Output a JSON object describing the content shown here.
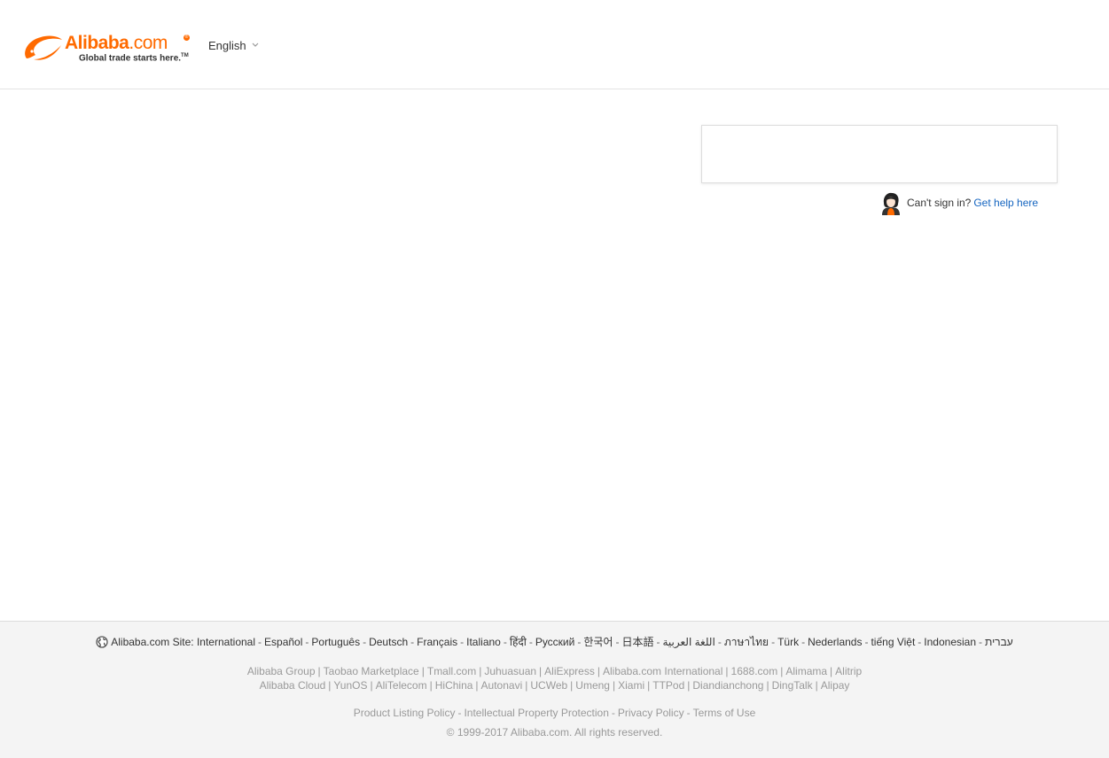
{
  "header": {
    "logo": {
      "wordmark_main": "Alibaba",
      "wordmark_suffix": ".com",
      "tagline": "Global trade starts here.",
      "trademark": "TM",
      "registered": "®"
    },
    "language": {
      "label": "English",
      "icon": "chevron-down-icon"
    }
  },
  "login": {
    "help_prefix": "Can't sign in?",
    "help_link": "Get help here"
  },
  "footer": {
    "site_label": "Alibaba.com Site:",
    "site_links": [
      "International",
      "Español",
      "Português",
      "Deutsch",
      "Français",
      "Italiano",
      "हिंदी",
      "Русский",
      "한국어",
      "日本語",
      "اللغة العربية",
      "ภาษาไทย",
      "Türk",
      "Nederlands",
      "tiếng Việt",
      "Indonesian",
      "עברית"
    ],
    "group_row1": [
      "Alibaba Group",
      "Taobao Marketplace",
      "Tmall.com",
      "Juhuasuan",
      "AliExpress",
      "Alibaba.com International",
      "1688.com",
      "Alimama",
      "Alitrip"
    ],
    "group_row2": [
      "Alibaba Cloud",
      "YunOS",
      "AliTelecom",
      "HiChina",
      "Autonavi",
      "UCWeb",
      "Umeng",
      "Xiami",
      "TTPod",
      "Diandianchong",
      "DingTalk",
      "Alipay"
    ],
    "policies": [
      "Product Listing Policy",
      "Intellectual Property Protection",
      "Privacy Policy",
      "Terms of Use"
    ],
    "copyright": "© 1999-2017 Alibaba.com. All rights reserved."
  },
  "colors": {
    "brand": "#ff6a00",
    "link": "#1565c0",
    "footer_bg": "#f4f4f4"
  }
}
